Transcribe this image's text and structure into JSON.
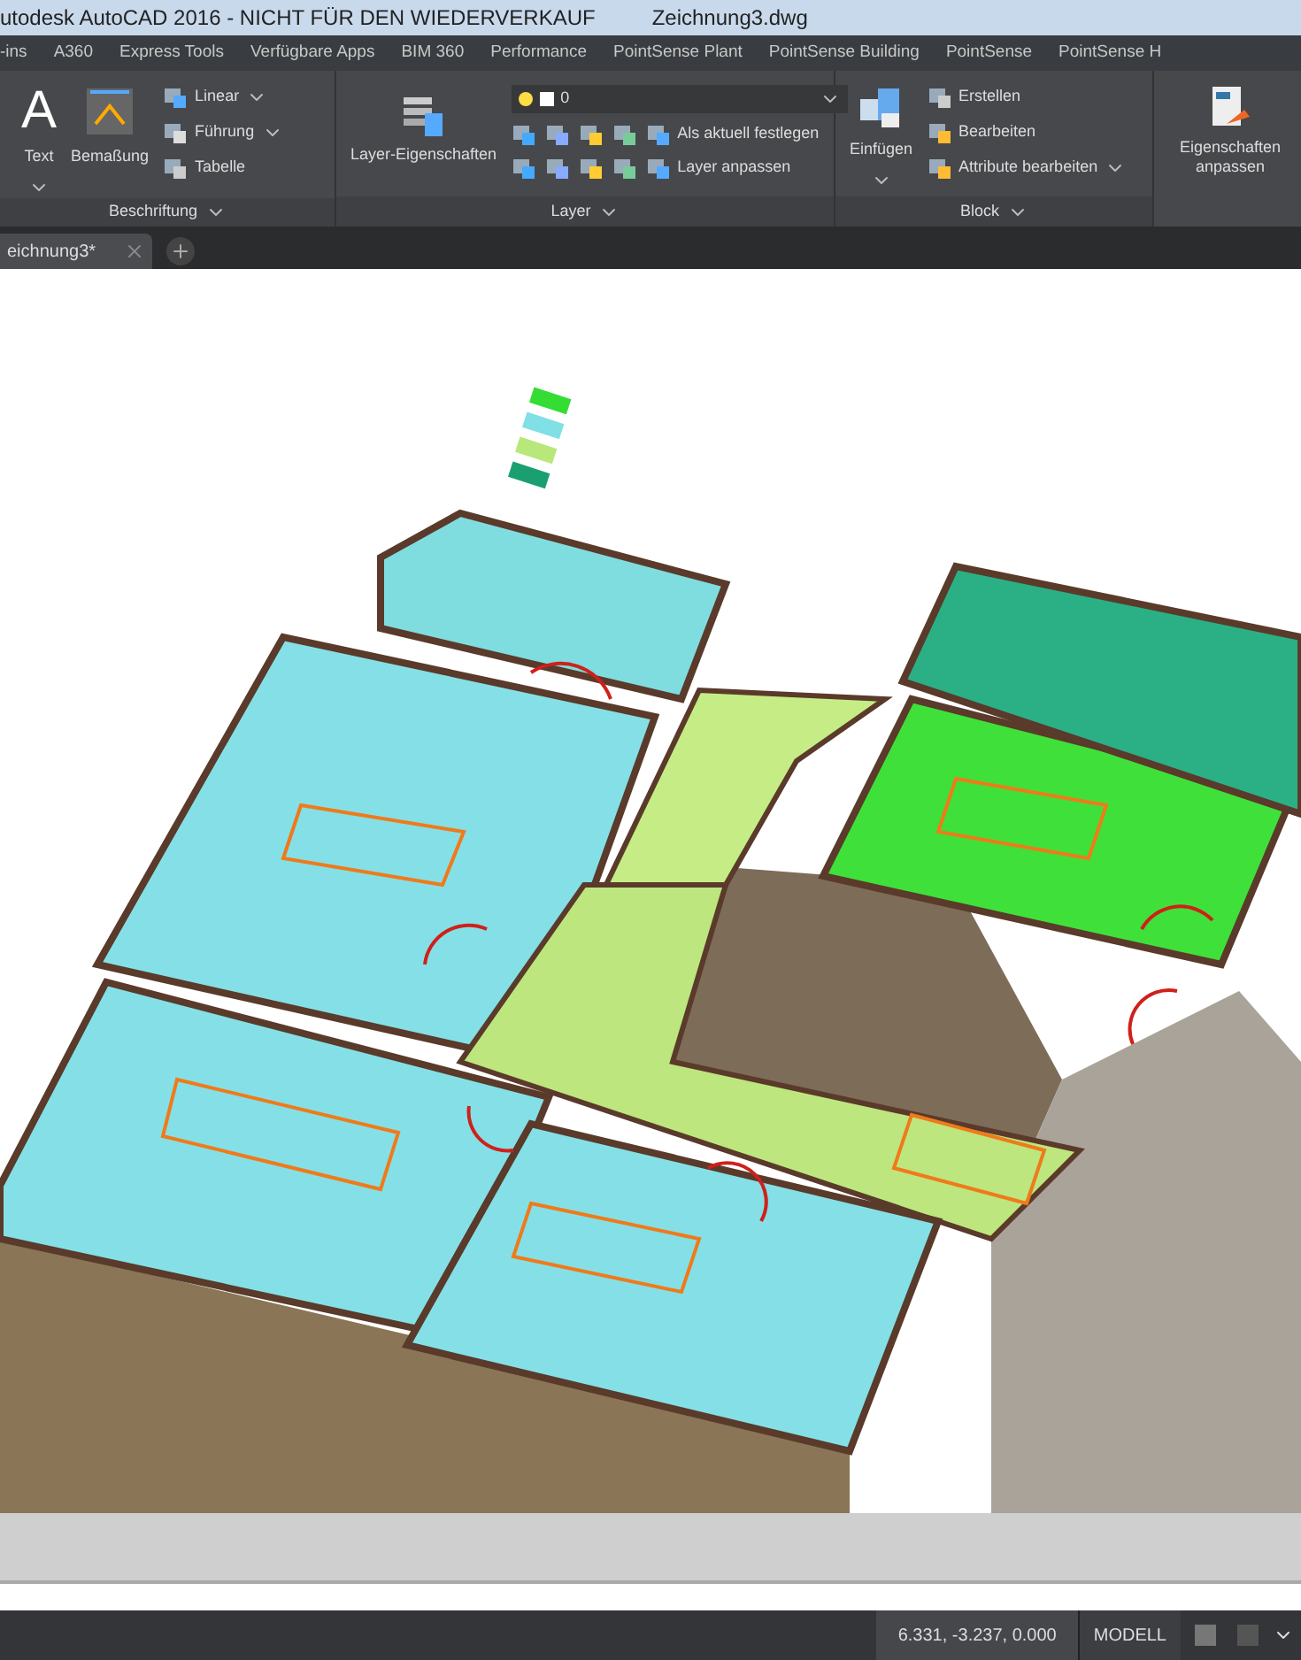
{
  "window": {
    "title": "utodesk AutoCAD 2016 - NICHT FÜR DEN WIEDERVERKAUF",
    "document": "Zeichnung3.dwg"
  },
  "ribbon_tabs": [
    "-ins",
    "A360",
    "Express Tools",
    "Verfügbare Apps",
    "BIM 360",
    "Performance",
    "PointSense Plant",
    "PointSense Building",
    "PointSense",
    "PointSense H"
  ],
  "ribbon": {
    "annotation": {
      "title": "Beschriftung",
      "text": {
        "glyph": "A",
        "label": "Text",
        "dropdown": true
      },
      "dimension": {
        "label": "Bemaßung",
        "dropdown": false
      },
      "small": [
        {
          "label": "Linear",
          "dropdown": true
        },
        {
          "label": "Führung",
          "dropdown": true
        },
        {
          "label": "Tabelle",
          "dropdown": false
        }
      ]
    },
    "layer": {
      "title": "Layer",
      "properties": "Layer-Eigenschaften",
      "current_layer": "0",
      "actions": [
        "Als aktuell festlegen",
        "Layer anpassen"
      ]
    },
    "block": {
      "title": "Block",
      "insert": {
        "label": "Einfügen",
        "dropdown": true
      },
      "small": [
        {
          "label": "Erstellen",
          "dropdown": false
        },
        {
          "label": "Bearbeiten",
          "dropdown": false
        },
        {
          "label": "Attribute bearbeiten",
          "dropdown": true
        }
      ]
    },
    "properties": {
      "label": "Eigenschaften anpassen"
    }
  },
  "file_tabs": [
    {
      "label": "eichnung3*",
      "selected": true
    }
  ],
  "status_bar": {
    "coordinates": "6.331, -3.237, 0.000",
    "space": "MODELL"
  }
}
